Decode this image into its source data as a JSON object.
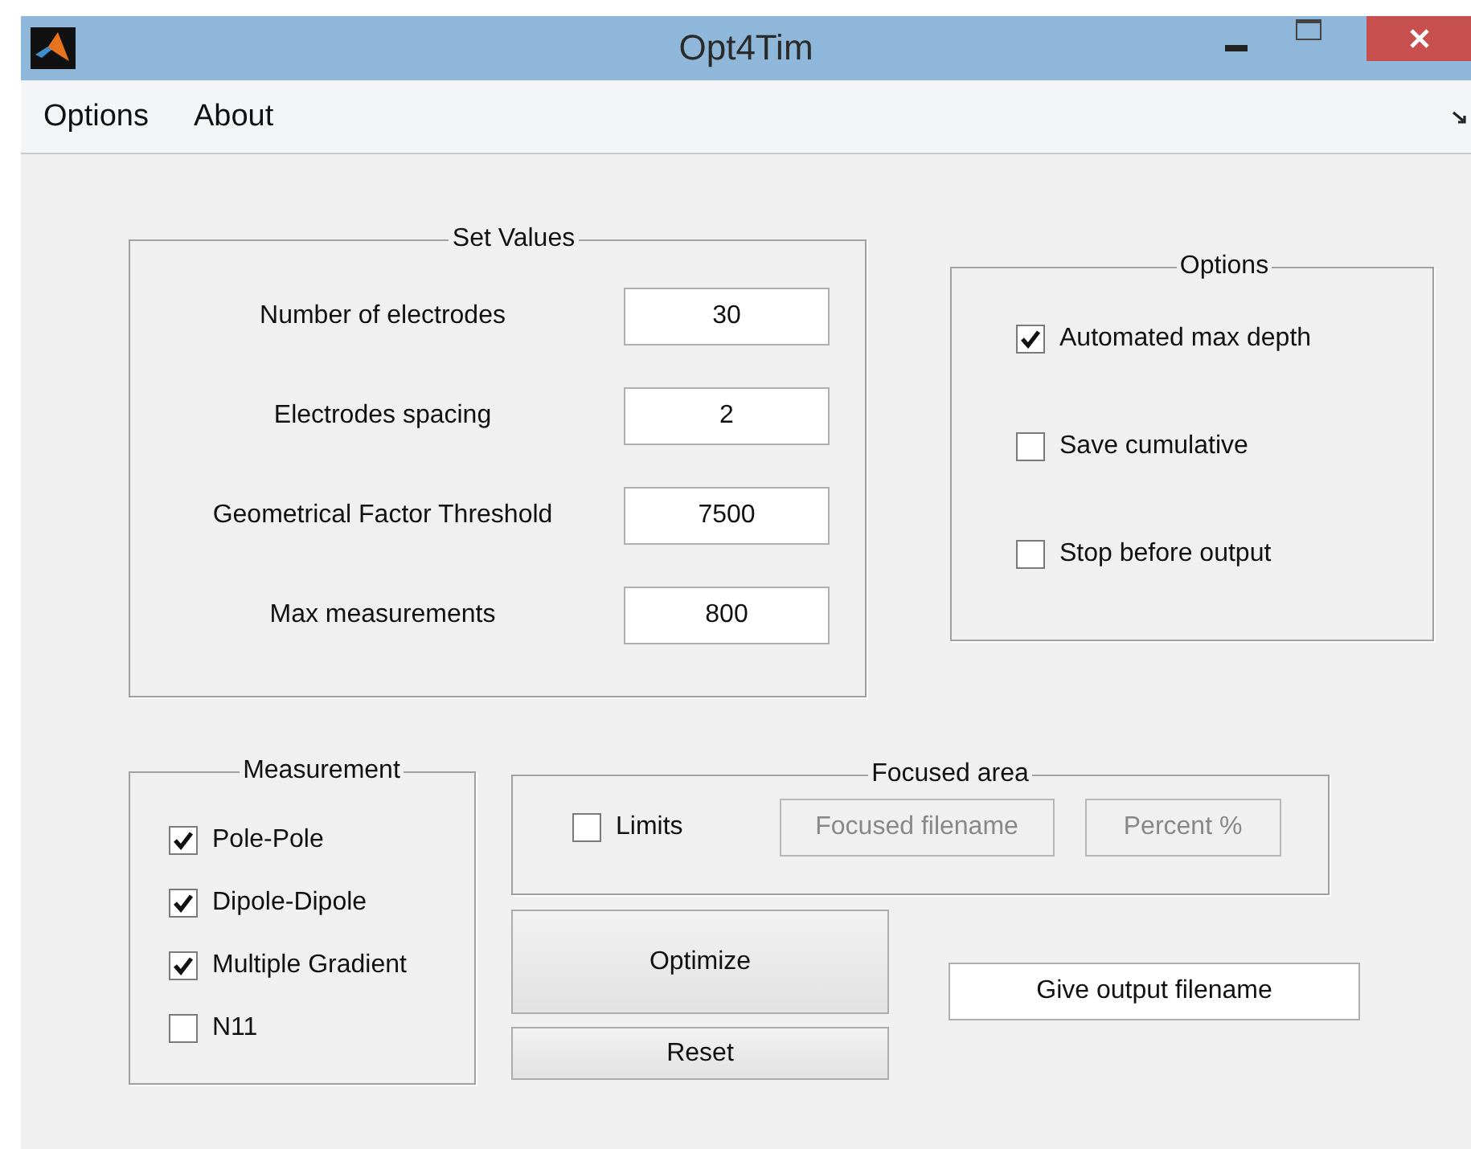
{
  "window": {
    "title": "Opt4Tim"
  },
  "menu": [
    {
      "label": "Options"
    },
    {
      "label": "About"
    }
  ],
  "set_values": {
    "title": "Set Values",
    "fields": [
      {
        "label": "Number of electrodes",
        "value": "30"
      },
      {
        "label": "Electrodes spacing",
        "value": "2"
      },
      {
        "label": "Geometrical Factor Threshold",
        "value": "7500"
      },
      {
        "label": "Max measurements",
        "value": "800"
      }
    ]
  },
  "options": {
    "title": "Options",
    "checkboxes": [
      {
        "label": "Automated max depth",
        "checked": true
      },
      {
        "label": "Save cumulative",
        "checked": false
      },
      {
        "label": "Stop before output",
        "checked": false
      }
    ]
  },
  "measurement": {
    "title": "Measurement",
    "checkboxes": [
      {
        "label": "Pole-Pole",
        "checked": true
      },
      {
        "label": "Dipole-Dipole",
        "checked": true
      },
      {
        "label": "Multiple Gradient",
        "checked": true
      },
      {
        "label": "N11",
        "checked": false
      }
    ]
  },
  "focused_area": {
    "title": "Focused area",
    "limits": {
      "label": "Limits",
      "checked": false
    },
    "fields": [
      {
        "value": "Focused filename",
        "disabled": true
      },
      {
        "value": "Percent %",
        "disabled": true
      }
    ]
  },
  "buttons": [
    {
      "label": "Optimize"
    },
    {
      "label": "Reset"
    }
  ],
  "output_field": {
    "value": "Give output filename"
  }
}
